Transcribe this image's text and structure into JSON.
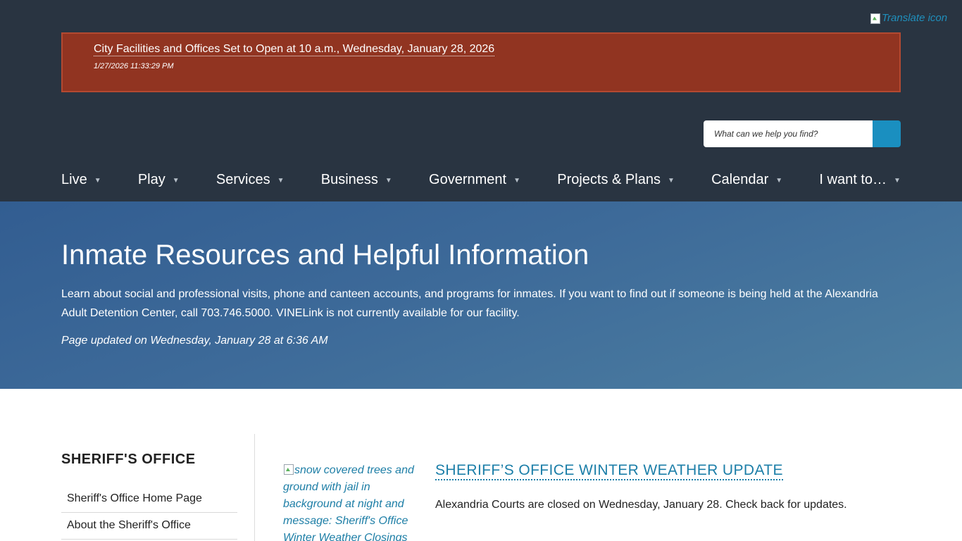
{
  "translate": {
    "alt_text": "Translate icon",
    "icon": "translate-icon"
  },
  "alert": {
    "title": "City Facilities and Offices Set to Open at 10 a.m., Wednesday, January 28, 2026",
    "date": "1/27/2026 11:33:29 PM"
  },
  "search": {
    "placeholder": "What can we help you find?",
    "icon": "search-icon"
  },
  "nav": {
    "caret_icon": "caret-down-icon",
    "items": [
      {
        "label": "Live"
      },
      {
        "label": "Play"
      },
      {
        "label": "Services"
      },
      {
        "label": "Business"
      },
      {
        "label": "Government"
      },
      {
        "label": "Projects & Plans"
      },
      {
        "label": "Calendar"
      },
      {
        "label": "I want to…"
      }
    ]
  },
  "hero": {
    "title": "Inmate Resources and Helpful Information",
    "description": "Learn about social and professional visits, phone and canteen accounts, and programs for inmates. If you want to find out if someone is being held at the Alexandria Adult Detention Center, call 703.746.5000. VINELink is not currently available for our facility.",
    "updated": "Page updated on Wednesday, January 28 at 6:36 AM"
  },
  "sidebar": {
    "title": "SHERIFF'S OFFICE",
    "links": [
      {
        "label": "Sheriff's Office Home Page"
      },
      {
        "label": "About the Sheriff's Office"
      }
    ]
  },
  "story": {
    "image_alt": "snow covered trees and ground with jail in background at night and message: Sheriff's Office Winter Weather Closings",
    "title": "SHERIFF’S OFFICE WINTER WEATHER UPDATE",
    "text": "Alexandria Courts are closed on Wednesday, January 28. Check back for updates."
  },
  "colors": {
    "header_bg": "#293441",
    "alert_bg": "#913421",
    "accent": "#1a8fc0",
    "hero_bg": "#3d6a99"
  }
}
